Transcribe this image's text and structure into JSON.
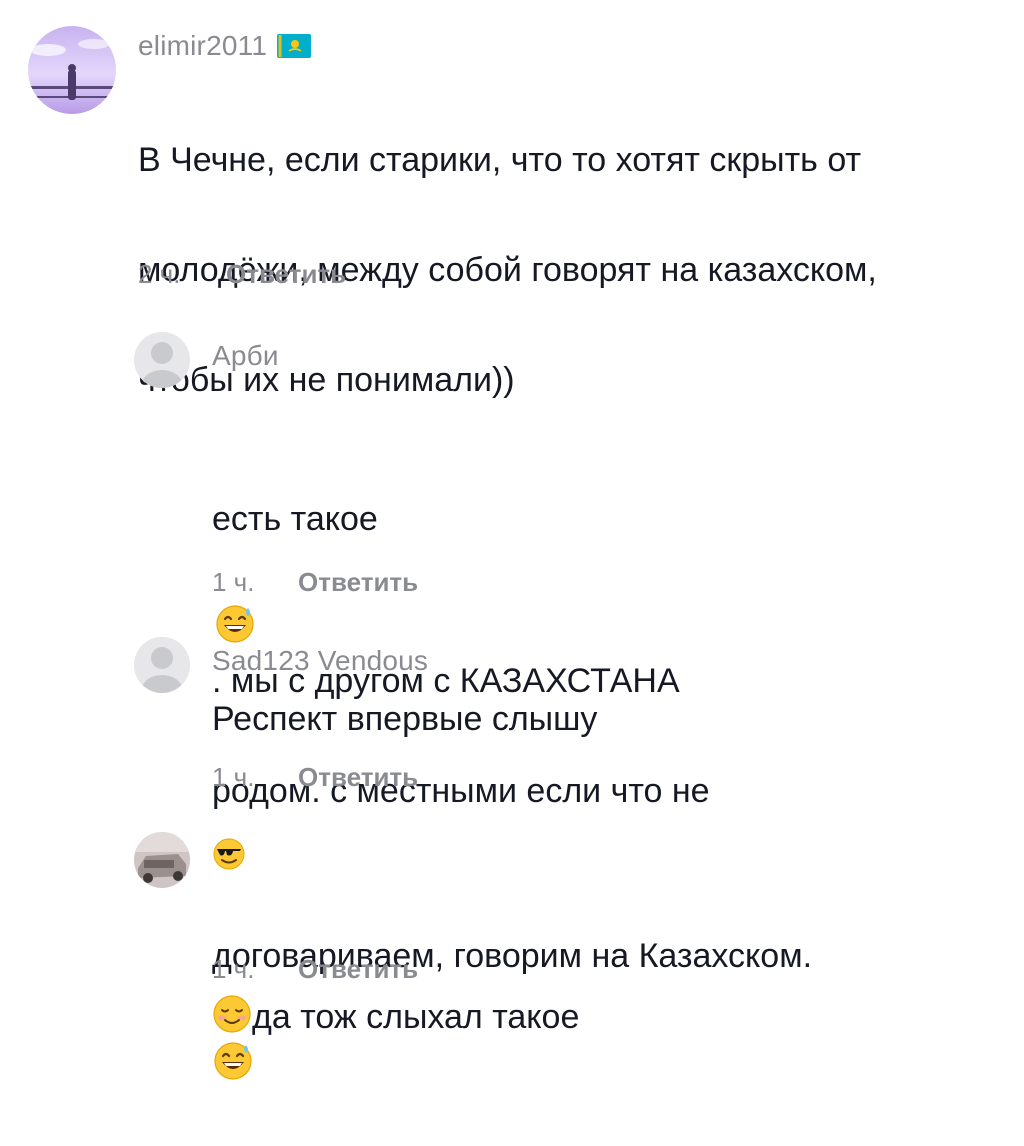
{
  "comments": [
    {
      "username": "elimir2011",
      "flag": "kazakhstan-flag",
      "text_lines": [
        "В Чечне, если старики, что то хотят скрыть от",
        "молодёжи, между собой говорят на казахском,",
        "чтобы их не понимали))"
      ],
      "time": "2 ч.",
      "reply_label": "Ответить"
    },
    {
      "username": "Арби",
      "text_line1_a": "есть такое",
      "text_line1_b": ". мы с другом с КАЗАХСТАНА",
      "text_line2": "родом. с местными если что не",
      "text_line3": "договариваем, говорим на Казахском.",
      "emoji": "grinning-sweat-emoji",
      "time": "1 ч.",
      "reply_label": "Ответить"
    },
    {
      "username": "Sad123 Vendous",
      "text": "Респект впервые слышу",
      "time": "1 ч.",
      "reply_label": "Ответить"
    },
    {
      "username_emoji": "sunglasses-emoji",
      "text_emoji": "relieved-smile-emoji",
      "text": "да тож слыхал такое",
      "time": "1 ч.",
      "reply_label": "Ответить"
    }
  ],
  "colors": {
    "primary_text": "#161823",
    "secondary_text": "#8a8b91",
    "background": "#ffffff"
  }
}
